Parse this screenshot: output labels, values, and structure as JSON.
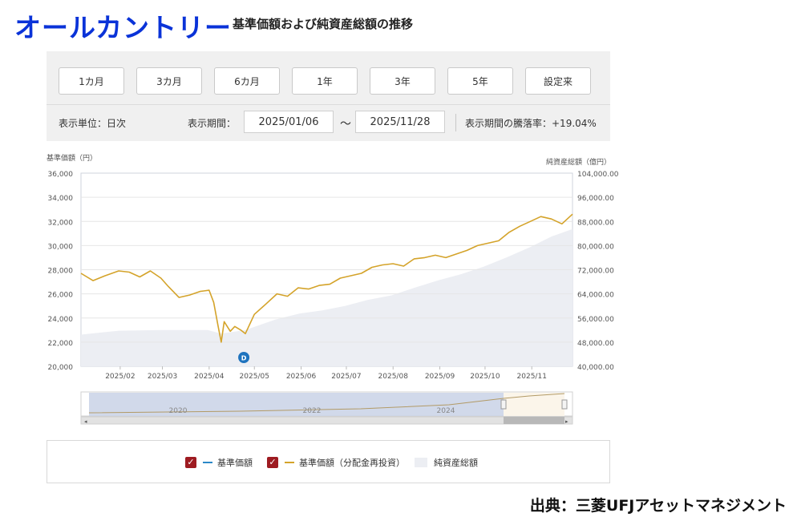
{
  "header": {
    "brand": "オールカントリー",
    "subtitle": "基準価額および純資産総額の推移"
  },
  "controls": {
    "period_buttons": [
      "1カ月",
      "3カ月",
      "6カ月",
      "1年",
      "3年",
      "5年",
      "設定来"
    ],
    "unit_label": "表示単位：日次",
    "period_label": "表示期間：",
    "start_date": "2025/01/06",
    "tilde": "〜",
    "end_date": "2025/11/28",
    "change_label": "表示期間の騰落率：+19.04%"
  },
  "chart_data": {
    "type": "line",
    "left_axis_label": "基準価額（円）",
    "right_axis_label": "純資産総額（億円）",
    "left_ylim": [
      20000,
      36000
    ],
    "right_ylim": [
      40000,
      104000
    ],
    "left_ticks": [
      "36,000",
      "34,000",
      "32,000",
      "30,000",
      "28,000",
      "26,000",
      "24,000",
      "22,000",
      "20,000"
    ],
    "right_ticks": [
      "104,000.00",
      "96,000.00",
      "88,000.00",
      "80,000.00",
      "72,000.00",
      "64,000.00",
      "56,000.00",
      "48,000.00",
      "40,000.00"
    ],
    "x_ticks": [
      "2025/02",
      "2025/03",
      "2025/04",
      "2025/05",
      "2025/06",
      "2025/07",
      "2025/08",
      "2025/09",
      "2025/10",
      "2025/11"
    ],
    "grid": true,
    "dividend_marker": {
      "label": "D",
      "date": "2025-04-24"
    },
    "series": [
      {
        "name": "基準価額（分配金再投資）",
        "color": "#d4a32a",
        "axis": "left",
        "points": [
          [
            "2025-01-06",
            27700
          ],
          [
            "2025-01-14",
            27100
          ],
          [
            "2025-01-22",
            27500
          ],
          [
            "2025-01-31",
            27900
          ],
          [
            "2025-02-07",
            27800
          ],
          [
            "2025-02-14",
            27400
          ],
          [
            "2025-02-21",
            27900
          ],
          [
            "2025-02-28",
            27300
          ],
          [
            "2025-03-05",
            26600
          ],
          [
            "2025-03-12",
            25700
          ],
          [
            "2025-03-19",
            25900
          ],
          [
            "2025-03-26",
            26200
          ],
          [
            "2025-04-01",
            26300
          ],
          [
            "2025-04-04",
            25300
          ],
          [
            "2025-04-07",
            23300
          ],
          [
            "2025-04-09",
            22000
          ],
          [
            "2025-04-11",
            23700
          ],
          [
            "2025-04-15",
            22900
          ],
          [
            "2025-04-18",
            23300
          ],
          [
            "2025-04-22",
            23000
          ],
          [
            "2025-04-25",
            22700
          ],
          [
            "2025-05-01",
            24300
          ],
          [
            "2025-05-09",
            25200
          ],
          [
            "2025-05-16",
            26000
          ],
          [
            "2025-05-23",
            25800
          ],
          [
            "2025-05-30",
            26500
          ],
          [
            "2025-06-06",
            26400
          ],
          [
            "2025-06-13",
            26700
          ],
          [
            "2025-06-20",
            26800
          ],
          [
            "2025-06-27",
            27300
          ],
          [
            "2025-07-04",
            27500
          ],
          [
            "2025-07-11",
            27700
          ],
          [
            "2025-07-18",
            28200
          ],
          [
            "2025-07-25",
            28400
          ],
          [
            "2025-08-01",
            28500
          ],
          [
            "2025-08-08",
            28300
          ],
          [
            "2025-08-15",
            28900
          ],
          [
            "2025-08-22",
            29000
          ],
          [
            "2025-08-29",
            29200
          ],
          [
            "2025-09-05",
            29000
          ],
          [
            "2025-09-12",
            29300
          ],
          [
            "2025-09-19",
            29600
          ],
          [
            "2025-09-26",
            30000
          ],
          [
            "2025-10-03",
            30200
          ],
          [
            "2025-10-10",
            30400
          ],
          [
            "2025-10-17",
            31100
          ],
          [
            "2025-10-24",
            31600
          ],
          [
            "2025-10-31",
            32000
          ],
          [
            "2025-11-07",
            32400
          ],
          [
            "2025-11-14",
            32200
          ],
          [
            "2025-11-21",
            31800
          ],
          [
            "2025-11-28",
            32600
          ]
        ]
      },
      {
        "name": "純資産総額",
        "color": "#eceef3",
        "axis": "right",
        "points": [
          [
            "2025-01-06",
            50500
          ],
          [
            "2025-01-31",
            51800
          ],
          [
            "2025-02-28",
            52000
          ],
          [
            "2025-03-31",
            52000
          ],
          [
            "2025-04-09",
            50800
          ],
          [
            "2025-04-25",
            52000
          ],
          [
            "2025-05-15",
            55500
          ],
          [
            "2025-05-31",
            57500
          ],
          [
            "2025-06-15",
            58500
          ],
          [
            "2025-06-30",
            60000
          ],
          [
            "2025-07-15",
            62000
          ],
          [
            "2025-07-31",
            63500
          ],
          [
            "2025-08-15",
            66000
          ],
          [
            "2025-08-31",
            68500
          ],
          [
            "2025-09-15",
            70500
          ],
          [
            "2025-09-30",
            73000
          ],
          [
            "2025-10-15",
            76000
          ],
          [
            "2025-10-31",
            79500
          ],
          [
            "2025-11-14",
            83000
          ],
          [
            "2025-11-28",
            85500
          ]
        ]
      }
    ],
    "navigator": {
      "year_labels": [
        "2020",
        "2022",
        "2024"
      ],
      "range_selection": "2025"
    }
  },
  "legend": {
    "items": [
      {
        "label": "基準価額",
        "color": "#2b88c8"
      },
      {
        "label": "基準価額（分配金再投資）",
        "color": "#d4a32a"
      },
      {
        "label": "純資産総額",
        "color": "#eceef3"
      }
    ]
  },
  "footer": {
    "source": "出典：三菱UFJアセットマネジメント"
  }
}
